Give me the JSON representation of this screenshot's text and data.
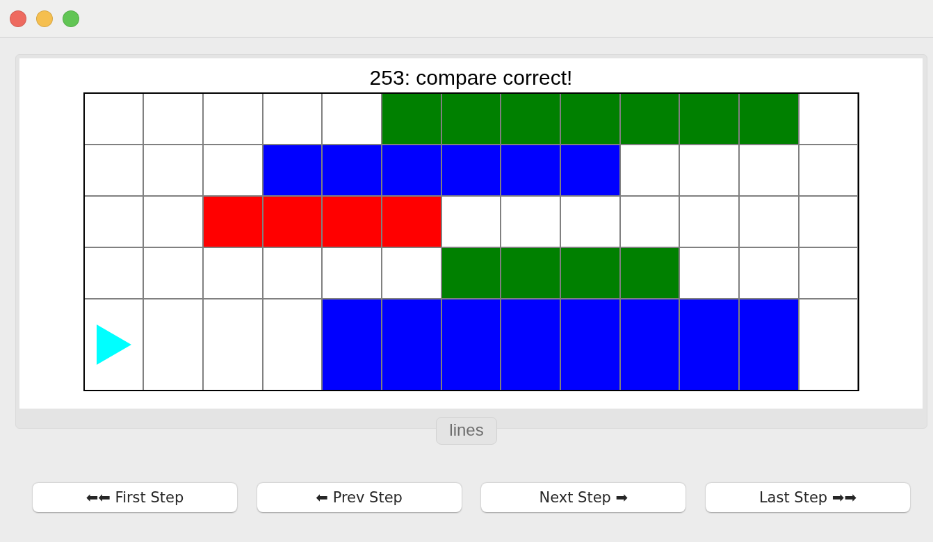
{
  "window": {
    "controls": [
      {
        "color": "#ee6a5f"
      },
      {
        "color": "#f5bf4f"
      },
      {
        "color": "#61c554"
      }
    ]
  },
  "board": {
    "title": "253: compare correct!",
    "rows": [
      {
        "cells": [
          {
            "kind": "plain",
            "color": "#ffffff"
          },
          {
            "kind": "plain",
            "color": "#ffffff"
          },
          {
            "kind": "plain",
            "color": "#ffffff"
          },
          {
            "kind": "plain",
            "color": "#ffffff"
          },
          {
            "kind": "plain",
            "color": "#ffffff"
          },
          {
            "kind": "plain",
            "color": "#008000"
          },
          {
            "kind": "plain",
            "color": "#008000"
          },
          {
            "kind": "plain",
            "color": "#008000"
          },
          {
            "kind": "plain",
            "color": "#008000"
          },
          {
            "kind": "plain",
            "color": "#008000"
          },
          {
            "kind": "plain",
            "color": "#008000"
          },
          {
            "kind": "plain",
            "color": "#008000"
          },
          {
            "kind": "plain",
            "color": "#ffffff"
          }
        ]
      },
      {
        "cells": [
          {
            "kind": "plain",
            "color": "#ffffff"
          },
          {
            "kind": "plain",
            "color": "#ffffff"
          },
          {
            "kind": "plain",
            "color": "#ffffff"
          },
          {
            "kind": "plain",
            "color": "#0000ff"
          },
          {
            "kind": "plain",
            "color": "#0000ff"
          },
          {
            "kind": "plain",
            "color": "#0000ff"
          },
          {
            "kind": "plain",
            "color": "#0000ff"
          },
          {
            "kind": "plain",
            "color": "#0000ff"
          },
          {
            "kind": "plain",
            "color": "#0000ff"
          },
          {
            "kind": "plain",
            "color": "#ffffff"
          },
          {
            "kind": "plain",
            "color": "#ffffff"
          },
          {
            "kind": "plain",
            "color": "#ffffff"
          },
          {
            "kind": "plain",
            "color": "#ffffff"
          }
        ]
      },
      {
        "cells": [
          {
            "kind": "plain",
            "color": "#ffffff"
          },
          {
            "kind": "plain",
            "color": "#ffffff"
          },
          {
            "kind": "plain",
            "color": "#ff0000"
          },
          {
            "kind": "plain",
            "color": "#ff0000"
          },
          {
            "kind": "plain",
            "color": "#ff0000"
          },
          {
            "kind": "plain",
            "color": "#ff0000"
          },
          {
            "kind": "plain",
            "color": "#ffffff"
          },
          {
            "kind": "plain",
            "color": "#ffffff"
          },
          {
            "kind": "plain",
            "color": "#ffffff"
          },
          {
            "kind": "plain",
            "color": "#ffffff"
          },
          {
            "kind": "plain",
            "color": "#ffffff"
          },
          {
            "kind": "plain",
            "color": "#ffffff"
          },
          {
            "kind": "plain",
            "color": "#ffffff"
          }
        ]
      },
      {
        "cells": [
          {
            "kind": "plain",
            "color": "#ffffff"
          },
          {
            "kind": "plain",
            "color": "#ffffff"
          },
          {
            "kind": "plain",
            "color": "#ffffff"
          },
          {
            "kind": "plain",
            "color": "#ffffff"
          },
          {
            "kind": "plain",
            "color": "#ffffff"
          },
          {
            "kind": "plain",
            "color": "#ffffff"
          },
          {
            "kind": "plain",
            "color": "#008000"
          },
          {
            "kind": "plain",
            "color": "#008000"
          },
          {
            "kind": "plain",
            "color": "#008000"
          },
          {
            "kind": "plain",
            "color": "#008000"
          },
          {
            "kind": "plain",
            "color": "#ffffff"
          },
          {
            "kind": "plain",
            "color": "#ffffff"
          },
          {
            "kind": "plain",
            "color": "#ffffff"
          }
        ]
      },
      {
        "cells": [
          {
            "kind": "arrow",
            "color": "#ffffff"
          },
          {
            "kind": "plain",
            "color": "#ffffff"
          },
          {
            "kind": "plain",
            "color": "#ffffff"
          },
          {
            "kind": "plain",
            "color": "#ffffff"
          },
          {
            "kind": "plain",
            "color": "#0000ff"
          },
          {
            "kind": "plain",
            "color": "#0000ff"
          },
          {
            "kind": "plain",
            "color": "#0000ff"
          },
          {
            "kind": "plain",
            "color": "#0000ff"
          },
          {
            "kind": "plain",
            "color": "#0000ff"
          },
          {
            "kind": "plain",
            "color": "#0000ff"
          },
          {
            "kind": "plain",
            "color": "#0000ff"
          },
          {
            "kind": "plain",
            "color": "#0000ff"
          },
          {
            "kind": "plain",
            "color": "#ffffff"
          }
        ]
      }
    ]
  },
  "tabs": [
    {
      "label": "lines",
      "selected": false
    }
  ],
  "buttons": [
    "⬅⬅ First Step",
    "⬅ Prev Step",
    "Next Step ➡",
    "Last Step ➡➡"
  ]
}
